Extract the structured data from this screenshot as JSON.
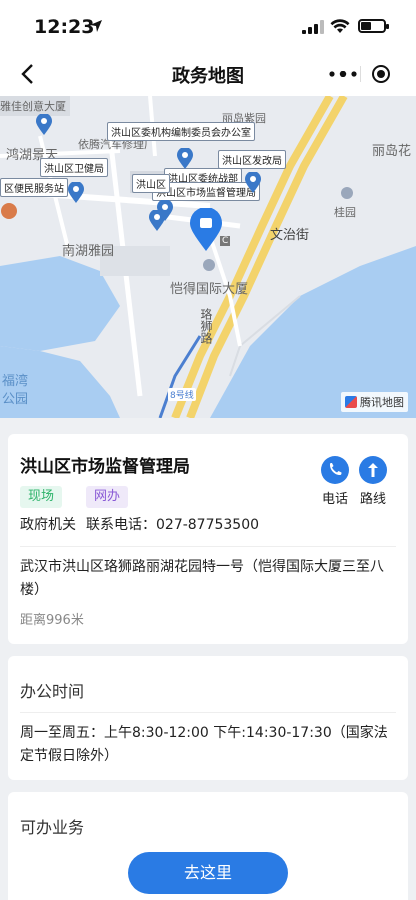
{
  "status_bar": {
    "time": "12:23"
  },
  "nav": {
    "title": "政务地图"
  },
  "map": {
    "places": [
      "雅佳创意大厦",
      "鸿湖景天",
      "依腾汽车修理厂",
      "丽岛紫园",
      "丽岛花",
      "桂园",
      "南湖雅园",
      "文治街",
      "恺得国际大厦",
      "珞狮路",
      "福湾",
      "公园",
      "8号线"
    ],
    "poi_labels": [
      "洪山区委机构编制委员会办公室",
      "洪山区发改局",
      "洪山区卫健局",
      "区便民服务站",
      "洪山区委统战部",
      "洪山区市场监督管理局",
      "洪山区"
    ],
    "metro_letter": "C",
    "provider": "腾讯地图"
  },
  "info": {
    "name": "洪山区市场监督管理局",
    "tags": [
      "现场",
      "网办"
    ],
    "type": "政府机关",
    "phone_label": "联系电话：",
    "phone": "027-87753500",
    "call_label": "电话",
    "route_label": "路线",
    "address": "武汉市洪山区珞狮路丽湖花园特一号（恺得国际大厦三至八楼）",
    "distance": "距离996米"
  },
  "hours": {
    "title": "办公时间",
    "text": "周一至周五：上午8:30-12:00 下午:14:30-17:30（国家法定节假日除外）"
  },
  "services": {
    "title": "可办业务"
  },
  "go_button": "去这里",
  "colors": {
    "accent": "#2a7be4",
    "water": "#a9cdf2",
    "onsite": "#2db36a",
    "online": "#8a5ad6"
  }
}
